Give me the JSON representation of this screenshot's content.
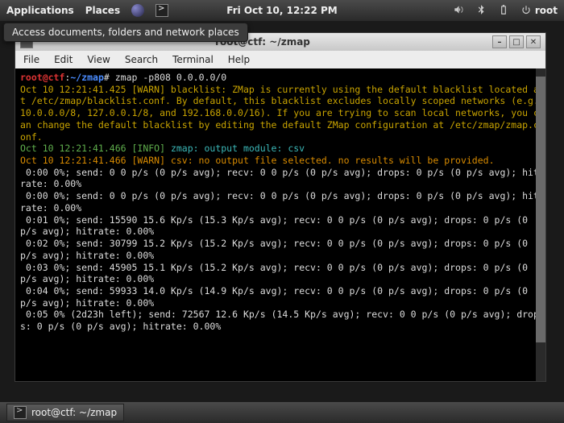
{
  "panel": {
    "applications": "Applications",
    "places": "Places",
    "clock": "Fri Oct 10, 12:22 PM",
    "root_label": "root"
  },
  "tooltip": "Access documents, folders and network places",
  "window": {
    "title_prefix": "root@ctf: ~/zmap",
    "menubar": [
      "File",
      "Edit",
      "View",
      "Search",
      "Terminal",
      "Help"
    ]
  },
  "prompt": {
    "user": "root@ctf",
    "colon": ":",
    "path": "~/zmap",
    "hash": "#",
    "command": "zmap -p808 0.0.0.0/0"
  },
  "lines": {
    "warn1": "Oct 10 12:21:41.425 [WARN] blacklist: ZMap is currently using the default blacklist located at /etc/zmap/blacklist.conf. By default, this blacklist excludes locally scoped networks (e.g. 10.0.0.0/8, 127.0.0.1/8, and 192.168.0.0/16). If you are trying to scan local networks, you can change the default blacklist by editing the default ZMap configuration at /etc/zmap/zmap.conf.",
    "info1_a": "Oct 10 12:21:41.466 [INFO] ",
    "info1_b": "zmap: output module: csv",
    "warn2": "Oct 10 12:21:41.466 [WARN] csv: no output file selected. no results will be provided.",
    "s0a": " 0:00 0%; send: 0 0 p/s (0 p/s avg); recv: 0 0 p/s (0 p/s avg); drops: 0 p/s (0 p/s avg); hitrate: 0.00%",
    "s0b": " 0:00 0%; send: 0 0 p/s (0 p/s avg); recv: 0 0 p/s (0 p/s avg); drops: 0 p/s (0 p/s avg); hitrate: 0.00%",
    "s1": " 0:01 0%; send: 15590 15.6 Kp/s (15.3 Kp/s avg); recv: 0 0 p/s (0 p/s avg); drops: 0 p/s (0 p/s avg); hitrate: 0.00%",
    "s2": " 0:02 0%; send: 30799 15.2 Kp/s (15.2 Kp/s avg); recv: 0 0 p/s (0 p/s avg); drops: 0 p/s (0 p/s avg); hitrate: 0.00%",
    "s3": " 0:03 0%; send: 45905 15.1 Kp/s (15.2 Kp/s avg); recv: 0 0 p/s (0 p/s avg); drops: 0 p/s (0 p/s avg); hitrate: 0.00%",
    "s4": " 0:04 0%; send: 59933 14.0 Kp/s (14.9 Kp/s avg); recv: 0 0 p/s (0 p/s avg); drops: 0 p/s (0 p/s avg); hitrate: 0.00%",
    "s5": " 0:05 0% (2d23h left); send: 72567 12.6 Kp/s (14.5 Kp/s avg); recv: 0 0 p/s (0 p/s avg); drops: 0 p/s (0 p/s avg); hitrate: 0.00%"
  },
  "taskbar": {
    "btn": "root@ctf: ~/zmap"
  }
}
